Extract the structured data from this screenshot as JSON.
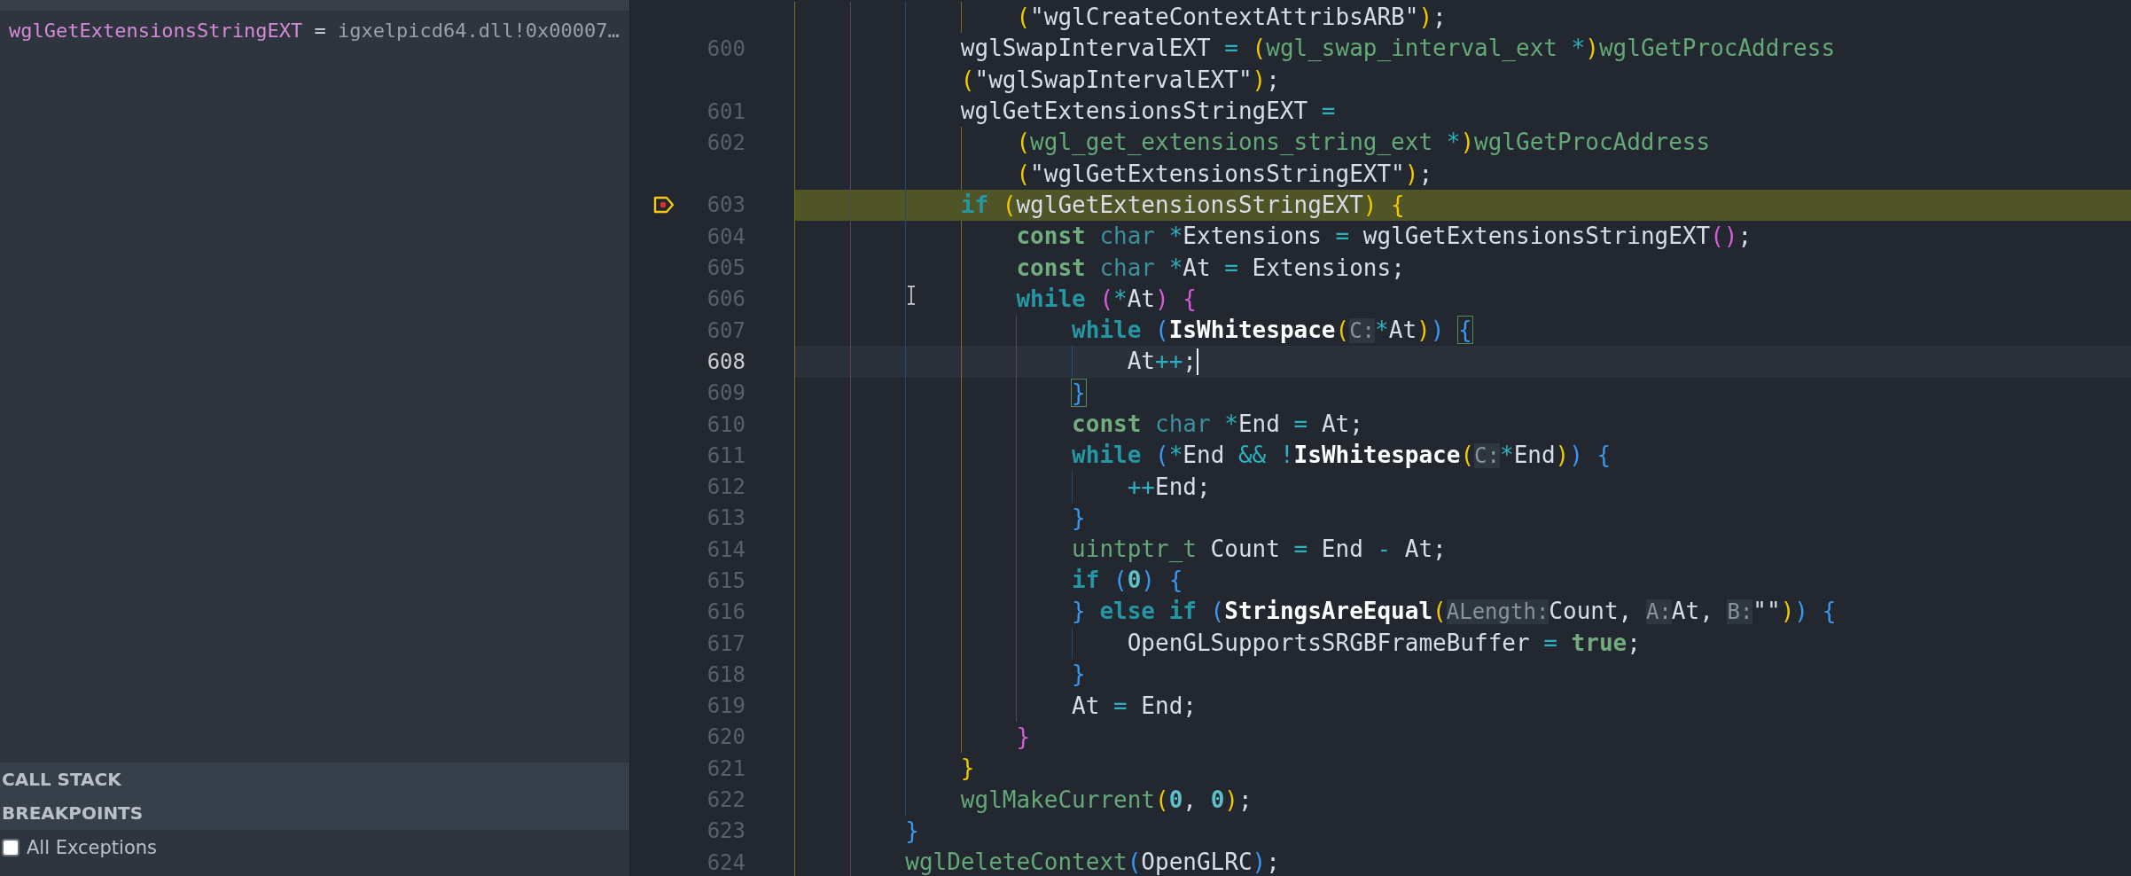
{
  "sidebar": {
    "watch": [
      {
        "name": "wglGetExtensionsStringEXT",
        "sep": "=",
        "value": "igxelpicd64.dll!0x00007…"
      }
    ],
    "sections": [
      {
        "title": "CALL STACK"
      },
      {
        "title": "BREAKPOINTS"
      }
    ],
    "breakpoints": [
      {
        "label": "All Exceptions",
        "checked": false
      }
    ]
  },
  "editor": {
    "lines": [
      {
        "tokens": [
          {
            "t": "                (",
            "kind": "y"
          },
          {
            "t": "\"wglCreateContextAttribsARB\"",
            "kind": "p"
          },
          {
            "t": ")",
            "kind": "y"
          },
          {
            "t": ";",
            "kind": "p"
          }
        ]
      },
      {
        "number": "600",
        "tokens": [
          {
            "t": "            wglSwapIntervalEXT ",
            "kind": "p"
          },
          {
            "t": "=",
            "kind": "op"
          },
          {
            "t": " (",
            "kind": "y"
          },
          {
            "t": "wgl_swap_interval_ext ",
            "kind": "tyg"
          },
          {
            "t": "*",
            "kind": "op"
          },
          {
            "t": ")",
            "kind": "y"
          },
          {
            "t": "wglGetProcAddress",
            "kind": "tyg"
          }
        ]
      },
      {
        "tokens": [
          {
            "t": "            (",
            "kind": "y"
          },
          {
            "t": "\"wglSwapIntervalEXT\"",
            "kind": "p"
          },
          {
            "t": ")",
            "kind": "y"
          },
          {
            "t": ";",
            "kind": "p"
          }
        ]
      },
      {
        "number": "601",
        "tokens": [
          {
            "t": "            wglGetExtensionsStringEXT ",
            "kind": "p"
          },
          {
            "t": "=",
            "kind": "op"
          }
        ]
      },
      {
        "number": "602",
        "tokens": [
          {
            "t": "                (",
            "kind": "y"
          },
          {
            "t": "wgl_get_extensions_string_ext ",
            "kind": "tyg"
          },
          {
            "t": "*",
            "kind": "op"
          },
          {
            "t": ")",
            "kind": "y"
          },
          {
            "t": "wglGetProcAddress",
            "kind": "tyg"
          }
        ]
      },
      {
        "tokens": [
          {
            "t": "                (",
            "kind": "y"
          },
          {
            "t": "\"wglGetExtensionsStringEXT\"",
            "kind": "p"
          },
          {
            "t": ")",
            "kind": "y"
          },
          {
            "t": ";",
            "kind": "p"
          }
        ]
      },
      {
        "number": "603",
        "breakpoint": true,
        "paused": true,
        "tokens": [
          {
            "t": "            if",
            "kind": "kw"
          },
          {
            "t": " (",
            "kind": "y"
          },
          {
            "t": "wglGetExtensionsStringEXT",
            "kind": "p"
          },
          {
            "t": ") {",
            "kind": "y"
          }
        ]
      },
      {
        "number": "604",
        "tokens": [
          {
            "t": "                const",
            "kind": "kw2"
          },
          {
            "t": " char",
            "kind": "ty"
          },
          {
            "t": " *",
            "kind": "op"
          },
          {
            "t": "Extensions ",
            "kind": "p"
          },
          {
            "t": "=",
            "kind": "op"
          },
          {
            "t": " wglGetExtensionsStringEXT",
            "kind": "p"
          },
          {
            "t": "()",
            "kind": "pk"
          },
          {
            "t": ";",
            "kind": "p"
          }
        ]
      },
      {
        "number": "605",
        "tokens": [
          {
            "t": "                const",
            "kind": "kw2"
          },
          {
            "t": " char",
            "kind": "ty"
          },
          {
            "t": " *",
            "kind": "op"
          },
          {
            "t": "At ",
            "kind": "p"
          },
          {
            "t": "=",
            "kind": "op"
          },
          {
            "t": " Extensions;",
            "kind": "p"
          }
        ]
      },
      {
        "number": "606",
        "tokens": [
          {
            "t": "                while",
            "kind": "kw"
          },
          {
            "t": " (",
            "kind": "pk"
          },
          {
            "t": "*",
            "kind": "op"
          },
          {
            "t": "At",
            "kind": "p"
          },
          {
            "t": ") {",
            "kind": "pk"
          }
        ]
      },
      {
        "number": "607",
        "tokens": [
          {
            "t": "                    while",
            "kind": "kw"
          },
          {
            "t": " (",
            "kind": "bl"
          },
          {
            "t": "IsWhitespace",
            "kind": "fn"
          },
          {
            "t": "(",
            "kind": "y"
          },
          {
            "t": "C:",
            "kind": "hint"
          },
          {
            "t": "*",
            "kind": "op"
          },
          {
            "t": "At",
            "kind": "p"
          },
          {
            "t": ")",
            "kind": "y"
          },
          {
            "t": ") ",
            "kind": "bl"
          },
          {
            "t": "{",
            "kind": "match"
          }
        ]
      },
      {
        "number": "608",
        "current": true,
        "cursor": true,
        "tokens": [
          {
            "t": "                        At",
            "kind": "p"
          },
          {
            "t": "++",
            "kind": "op"
          },
          {
            "t": ";",
            "kind": "p"
          }
        ]
      },
      {
        "number": "609",
        "tokens": [
          {
            "t": "                    }",
            "kind": "match"
          }
        ]
      },
      {
        "number": "610",
        "tokens": [
          {
            "t": "                    const",
            "kind": "kw2"
          },
          {
            "t": " char",
            "kind": "ty"
          },
          {
            "t": " *",
            "kind": "op"
          },
          {
            "t": "End ",
            "kind": "p"
          },
          {
            "t": "=",
            "kind": "op"
          },
          {
            "t": " At;",
            "kind": "p"
          }
        ]
      },
      {
        "number": "611",
        "tokens": [
          {
            "t": "                    while",
            "kind": "kw"
          },
          {
            "t": " (",
            "kind": "bl"
          },
          {
            "t": "*",
            "kind": "op"
          },
          {
            "t": "End ",
            "kind": "p"
          },
          {
            "t": "&&",
            "kind": "op"
          },
          {
            "t": " !",
            "kind": "op"
          },
          {
            "t": "IsWhitespace",
            "kind": "fn"
          },
          {
            "t": "(",
            "kind": "y"
          },
          {
            "t": "C:",
            "kind": "hint"
          },
          {
            "t": "*",
            "kind": "op"
          },
          {
            "t": "End",
            "kind": "p"
          },
          {
            "t": ")",
            "kind": "y"
          },
          {
            "t": ") {",
            "kind": "bl"
          }
        ]
      },
      {
        "number": "612",
        "tokens": [
          {
            "t": "                        ++",
            "kind": "op"
          },
          {
            "t": "End;",
            "kind": "p"
          }
        ]
      },
      {
        "number": "613",
        "tokens": [
          {
            "t": "                    }",
            "kind": "bl"
          }
        ]
      },
      {
        "number": "614",
        "tokens": [
          {
            "t": "                    uintptr_t",
            "kind": "tyg"
          },
          {
            "t": " Count ",
            "kind": "p"
          },
          {
            "t": "=",
            "kind": "op"
          },
          {
            "t": " End ",
            "kind": "p"
          },
          {
            "t": "-",
            "kind": "op"
          },
          {
            "t": " At;",
            "kind": "p"
          }
        ]
      },
      {
        "number": "615",
        "tokens": [
          {
            "t": "                    if",
            "kind": "kw"
          },
          {
            "t": " (",
            "kind": "bl"
          },
          {
            "t": "0",
            "kind": "num"
          },
          {
            "t": ") {",
            "kind": "bl"
          }
        ]
      },
      {
        "number": "616",
        "tokens": [
          {
            "t": "                    }",
            "kind": "bl"
          },
          {
            "t": " else if",
            "kind": "kw"
          },
          {
            "t": " (",
            "kind": "bl"
          },
          {
            "t": "StringsAreEqual",
            "kind": "fn"
          },
          {
            "t": "(",
            "kind": "y"
          },
          {
            "t": "ALength:",
            "kind": "hint"
          },
          {
            "t": "Count, ",
            "kind": "p"
          },
          {
            "t": "A:",
            "kind": "hint"
          },
          {
            "t": "At, ",
            "kind": "p"
          },
          {
            "t": "B:",
            "kind": "hint"
          },
          {
            "t": "\"\"",
            "kind": "p"
          },
          {
            "t": ")",
            "kind": "y"
          },
          {
            "t": ") {",
            "kind": "bl"
          }
        ]
      },
      {
        "number": "617",
        "tokens": [
          {
            "t": "                        OpenGLSupportsSRGBFrameBuffer ",
            "kind": "p"
          },
          {
            "t": "=",
            "kind": "op"
          },
          {
            "t": " true",
            "kind": "kw2"
          },
          {
            "t": ";",
            "kind": "p"
          }
        ]
      },
      {
        "number": "618",
        "tokens": [
          {
            "t": "                    }",
            "kind": "bl"
          }
        ]
      },
      {
        "number": "619",
        "tokens": [
          {
            "t": "                    At ",
            "kind": "p"
          },
          {
            "t": "=",
            "kind": "op"
          },
          {
            "t": " End;",
            "kind": "p"
          }
        ]
      },
      {
        "number": "620",
        "tokens": [
          {
            "t": "                }",
            "kind": "pk"
          }
        ]
      },
      {
        "number": "621",
        "tokens": [
          {
            "t": "            }",
            "kind": "y"
          }
        ]
      },
      {
        "number": "622",
        "tokens": [
          {
            "t": "            wglMakeCurrent",
            "kind": "tyg"
          },
          {
            "t": "(",
            "kind": "y"
          },
          {
            "t": "0",
            "kind": "num"
          },
          {
            "t": ", ",
            "kind": "p"
          },
          {
            "t": "0",
            "kind": "num"
          },
          {
            "t": ")",
            "kind": "y"
          },
          {
            "t": ";",
            "kind": "p"
          }
        ]
      },
      {
        "number": "623",
        "tokens": [
          {
            "t": "        }",
            "kind": "bl"
          }
        ]
      },
      {
        "number": "624",
        "tokens": [
          {
            "t": "        wglDeleteContext",
            "kind": "tyg"
          },
          {
            "t": "(",
            "kind": "bl"
          },
          {
            "t": "OpenGLRC",
            "kind": "p"
          },
          {
            "t": ")",
            "kind": "bl"
          },
          {
            "t": ";",
            "kind": "p"
          }
        ]
      }
    ]
  }
}
